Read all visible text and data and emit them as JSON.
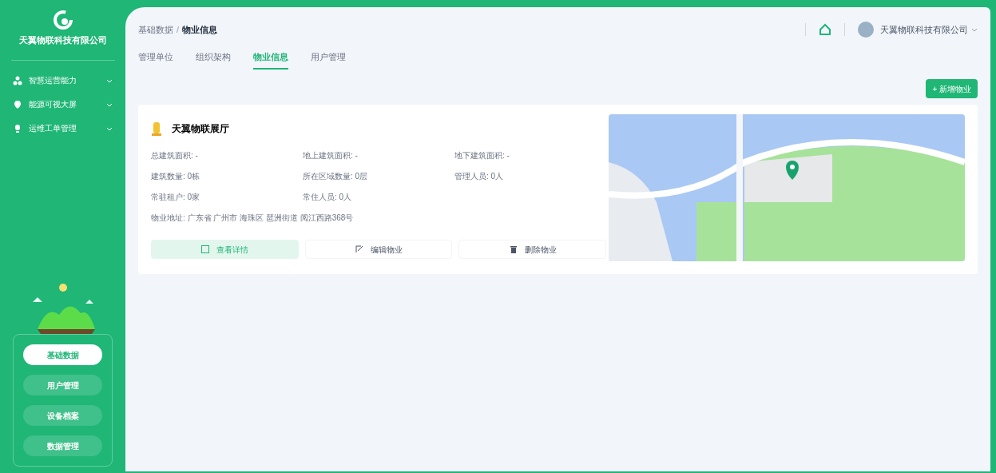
{
  "sidebar": {
    "company": "天翼物联科技有限公司",
    "menu": [
      {
        "label": "智慧运营能力",
        "kind": "nodes"
      },
      {
        "label": "能源可视大屏",
        "kind": "pin"
      },
      {
        "label": "运维工单管理",
        "kind": "bulb"
      }
    ],
    "modules": [
      {
        "label": "基础数据",
        "selected": true
      },
      {
        "label": "用户管理",
        "selected": false
      },
      {
        "label": "设备档案",
        "selected": false
      },
      {
        "label": "数据管理",
        "selected": false
      }
    ]
  },
  "header": {
    "breadcrumb": [
      "基础数据",
      "物业信息"
    ],
    "breadcrumb_separator": "/",
    "user": "天翼物联科技有限公司"
  },
  "tabs": [
    {
      "label": "管理单位",
      "selected": false
    },
    {
      "label": "组织架构",
      "selected": false
    },
    {
      "label": "物业信息",
      "selected": true
    },
    {
      "label": "用户管理",
      "selected": false
    }
  ],
  "add_button": "+ 新增物业",
  "property": {
    "name": "天翼物联展厅",
    "fields": [
      "总建筑面积: -",
      "地上建筑面积: -",
      "地下建筑面积: -",
      "建筑数量: 0栋",
      "所在区域数量: 0层",
      "管理人员: 0人",
      "常驻租户: 0家",
      "常住人员: 0人"
    ],
    "address": "物业地址: 广东省 广州市 海珠区 琶洲街道 阅江西路368号",
    "actions": [
      {
        "label": "查看详情",
        "kind": "view",
        "selected": true
      },
      {
        "label": "编辑物业",
        "kind": "edit",
        "selected": false
      },
      {
        "label": "删除物业",
        "kind": "delete",
        "selected": false
      }
    ]
  }
}
